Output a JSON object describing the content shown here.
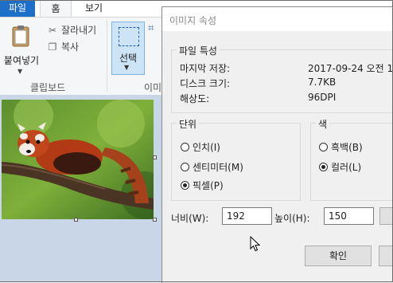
{
  "ribbon": {
    "tabs": [
      {
        "label": "파일"
      },
      {
        "label": "홈"
      },
      {
        "label": "보기"
      }
    ],
    "clipboard": {
      "paste_label": "붙여넣기",
      "cut_label": "잘라내기",
      "copy_label": "복사",
      "group_label": "클립보드"
    },
    "image": {
      "select_label": "선택",
      "group_label_partial": "이미"
    }
  },
  "dialog": {
    "title": "이미지 속성",
    "file_attributes": {
      "legend": "파일 특성",
      "rows": [
        {
          "label": "마지막 저장:",
          "value": "2017-09-24 오전 1"
        },
        {
          "label": "디스크 크기:",
          "value": "7.7KB"
        },
        {
          "label": "해상도:",
          "value": "96DPI"
        }
      ]
    },
    "units": {
      "legend": "단위",
      "options": [
        {
          "label": "인치(I)",
          "selected": false
        },
        {
          "label": "센티미터(M)",
          "selected": false
        },
        {
          "label": "픽셀(P)",
          "selected": true
        }
      ]
    },
    "colors": {
      "legend": "색",
      "options": [
        {
          "label": "흑백(B)",
          "selected": false
        },
        {
          "label": "컬러(L)",
          "selected": true
        }
      ]
    },
    "width": {
      "label": "너비(W):",
      "value": "192"
    },
    "height": {
      "label": "높이(H):",
      "value": "150"
    },
    "ok_label": "확인"
  },
  "colors": {
    "file_tab": "#1e6fc8",
    "select_highlight": "#cde4f7",
    "canvas_bg": "#c9d6e8",
    "dialog_bg": "#f0f0f0"
  }
}
